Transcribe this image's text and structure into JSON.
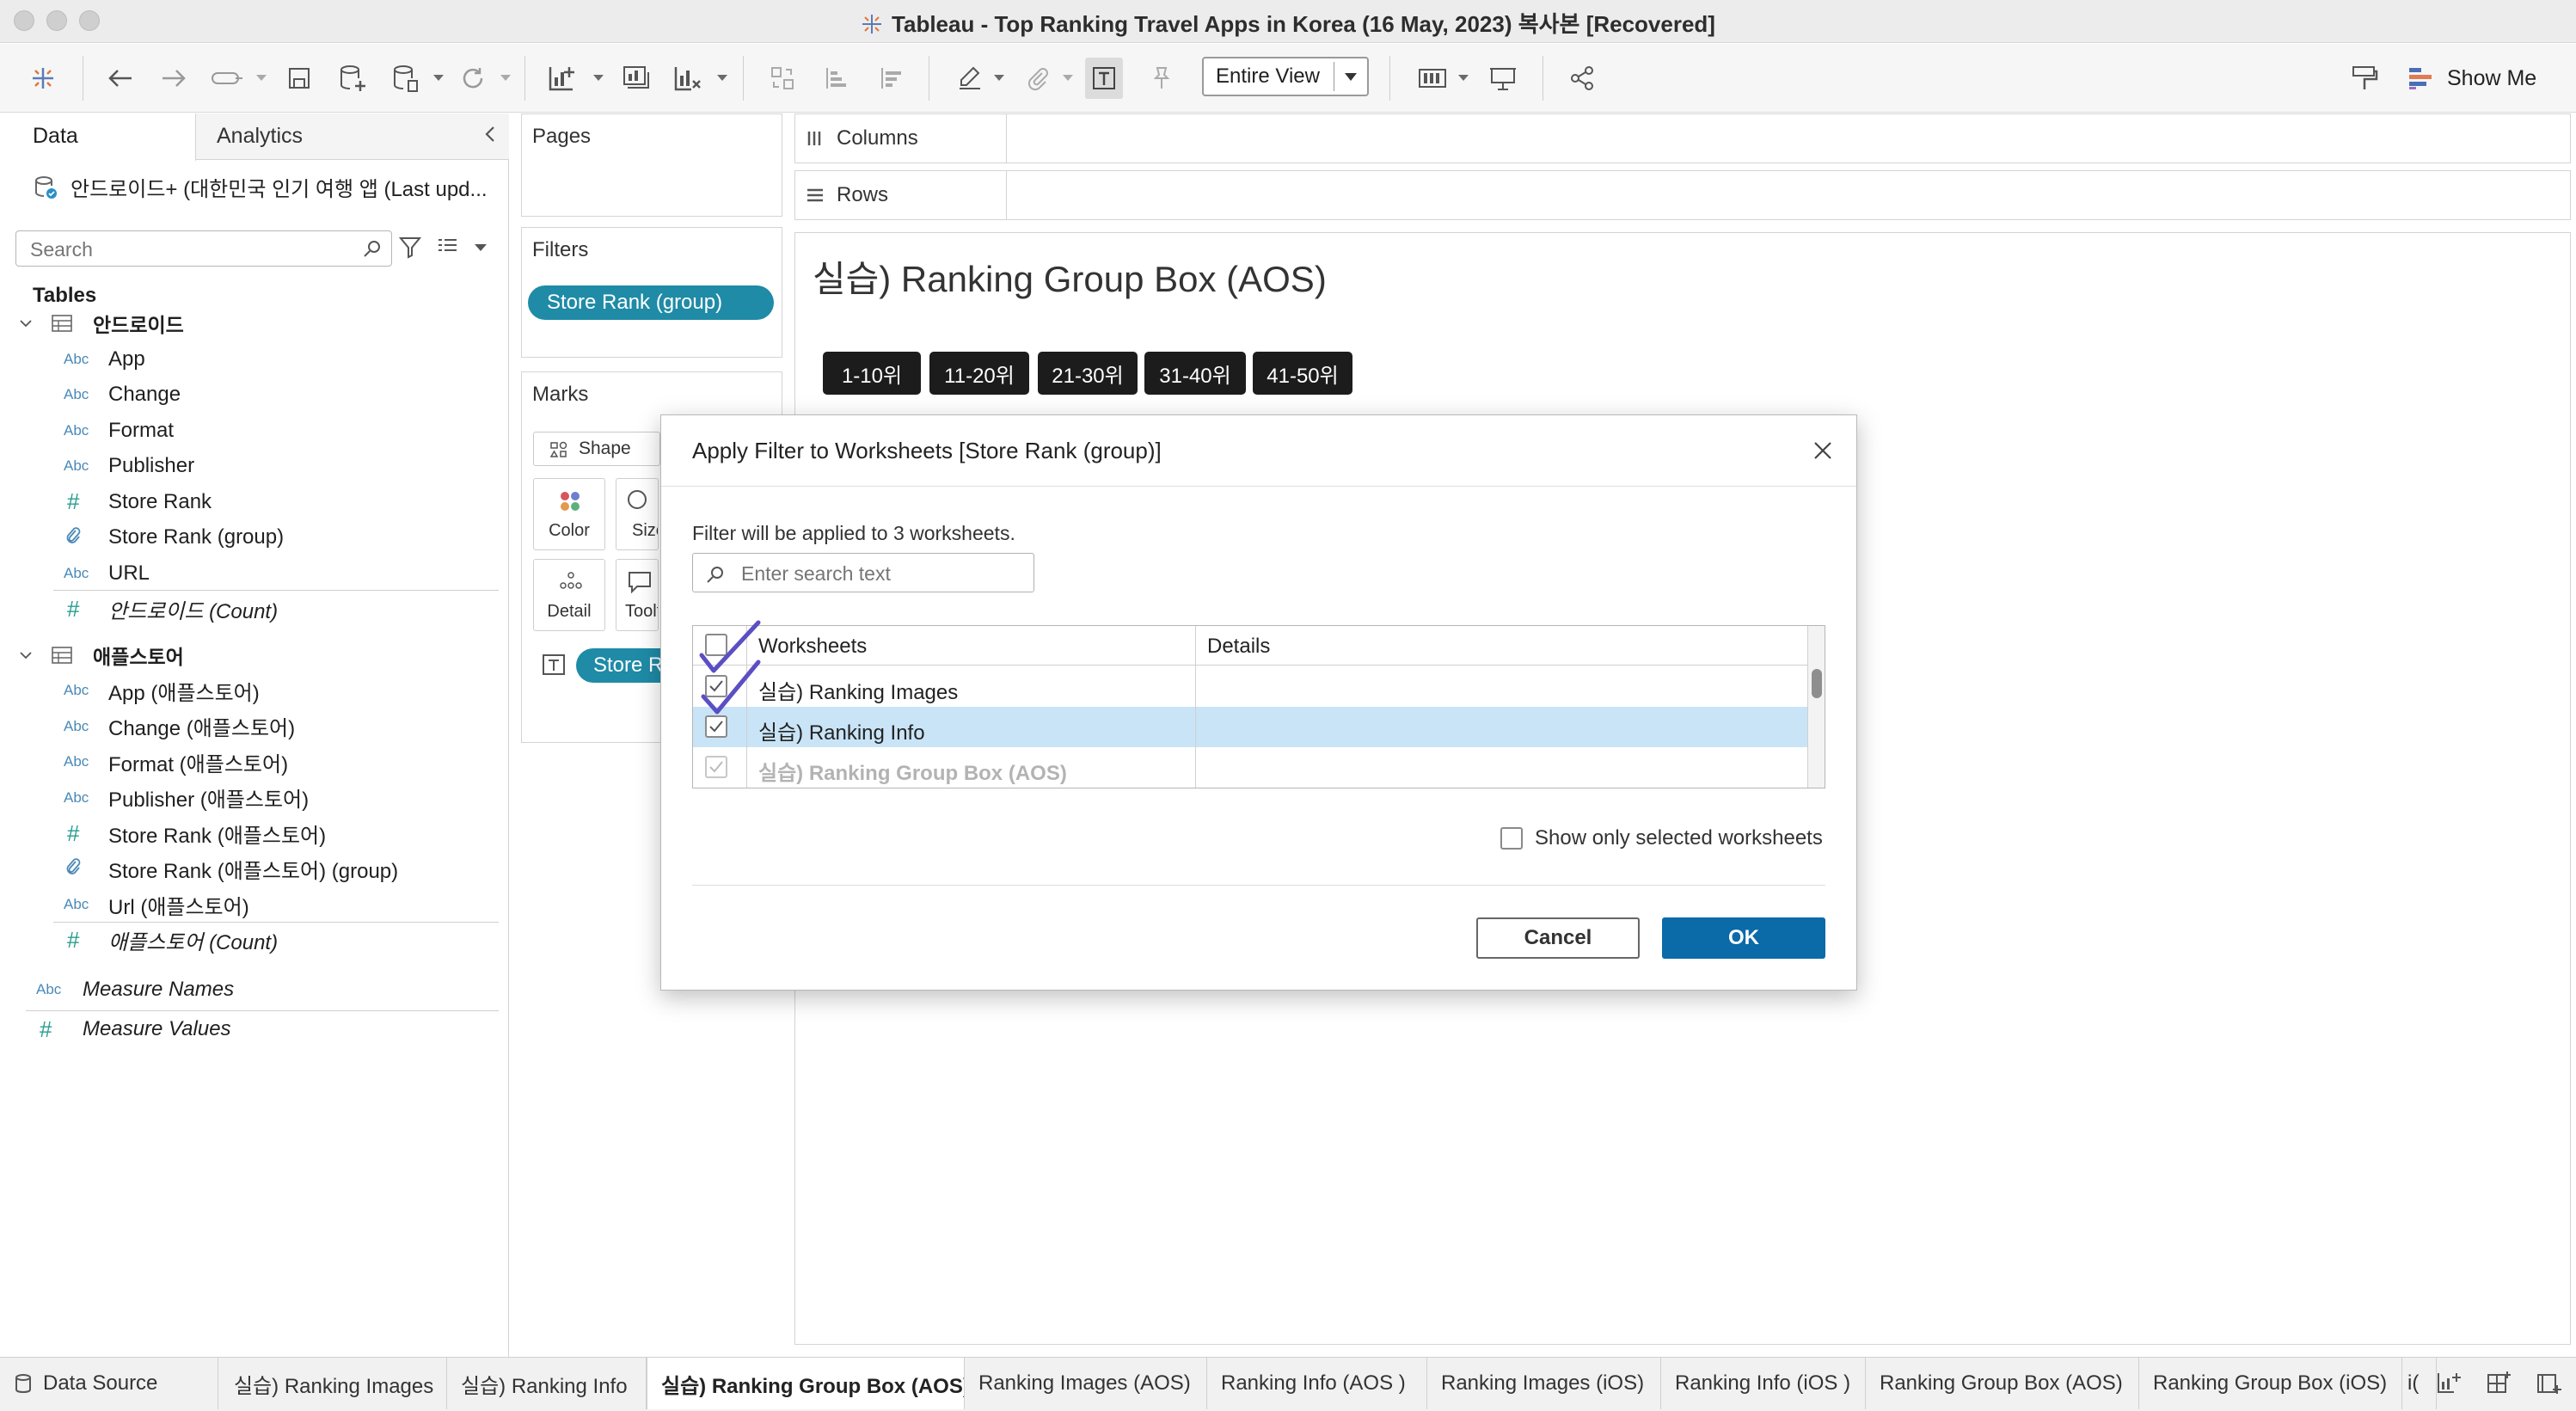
{
  "window": {
    "title": "Tableau - Top Ranking Travel Apps in Korea (16 May, 2023) 복사본 [Recovered]"
  },
  "toolbar": {
    "fit_value": "Entire View",
    "show_me_label": "Show Me"
  },
  "data_pane": {
    "tab_data": "Data",
    "tab_analytics": "Analytics",
    "datasource": "안드로이드+ (대한민국 인기 여행 앱 (Last upd...",
    "search_placeholder": "Search",
    "tables_header": "Tables",
    "table1": {
      "name": "안드로이드",
      "fields": [
        {
          "type": "Abc",
          "name": "App"
        },
        {
          "type": "Abc",
          "name": "Change"
        },
        {
          "type": "Abc",
          "name": "Format"
        },
        {
          "type": "Abc",
          "name": "Publisher"
        },
        {
          "type": "#",
          "name": "Store Rank"
        },
        {
          "type": "clip",
          "name": "Store Rank (group)"
        },
        {
          "type": "Abc",
          "name": "URL"
        },
        {
          "type": "#",
          "name": "안드로이드 (Count)"
        }
      ]
    },
    "table2": {
      "name": "애플스토어",
      "fields": [
        {
          "type": "Abc",
          "name": "App (애플스토어)"
        },
        {
          "type": "Abc",
          "name": "Change (애플스토어)"
        },
        {
          "type": "Abc",
          "name": "Format (애플스토어)"
        },
        {
          "type": "Abc",
          "name": "Publisher (애플스토어)"
        },
        {
          "type": "#",
          "name": "Store Rank (애플스토어)"
        },
        {
          "type": "clip",
          "name": "Store Rank (애플스토어) (group)"
        },
        {
          "type": "Abc",
          "name": "Url (애플스토어)"
        },
        {
          "type": "#",
          "name": "애플스토어 (Count)"
        }
      ]
    },
    "measure_names": {
      "type": "Abc",
      "name": "Measure Names"
    },
    "measure_values": {
      "type": "#",
      "name": "Measure Values"
    }
  },
  "cards": {
    "pages": "Pages",
    "filters": "Filters",
    "filter_pill": "Store Rank (group)",
    "marks": "Marks",
    "mark_type": "Shape",
    "color": "Color",
    "size": "Size",
    "detail": "Detail",
    "tooltip": "Tooltip",
    "marks_pill": "Store Rank (group)"
  },
  "shelves": {
    "columns": "Columns",
    "rows": "Rows"
  },
  "canvas": {
    "title": "실습) Ranking Group Box (AOS)",
    "rank_buttons": [
      "1-10위",
      "11-20위",
      "21-30위",
      "31-40위",
      "41-50위"
    ]
  },
  "dialog": {
    "title": "Apply Filter to Worksheets [Store Rank (group)]",
    "message": "Filter will be applied to 3 worksheets.",
    "search_placeholder": "Enter search text",
    "col_worksheets": "Worksheets",
    "col_details": "Details",
    "rows": [
      {
        "name": "실습) Ranking Images",
        "checked": true
      },
      {
        "name": "실습) Ranking Info",
        "checked": true
      },
      {
        "name": "실습) Ranking Group Box (AOS)",
        "checked": true
      }
    ],
    "show_only_label": "Show only selected worksheets",
    "cancel": "Cancel",
    "ok": "OK"
  },
  "sheet_tabs": [
    "Data Source",
    "실습) Ranking Images",
    "실습) Ranking Info",
    "실습) Ranking Group Box (AOS)",
    "Ranking Images (AOS)",
    "Ranking Info (AOS )",
    "Ranking Images (iOS)",
    "Ranking Info (iOS )",
    "Ranking Group Box (AOS)",
    "Ranking Group Box (iOS)",
    "i("
  ],
  "colors": {
    "pill": "#1f8ba6",
    "ok_button": "#0b6aa8",
    "selected_row": "#c9e4f6",
    "annotation": "#5b4fc4"
  }
}
